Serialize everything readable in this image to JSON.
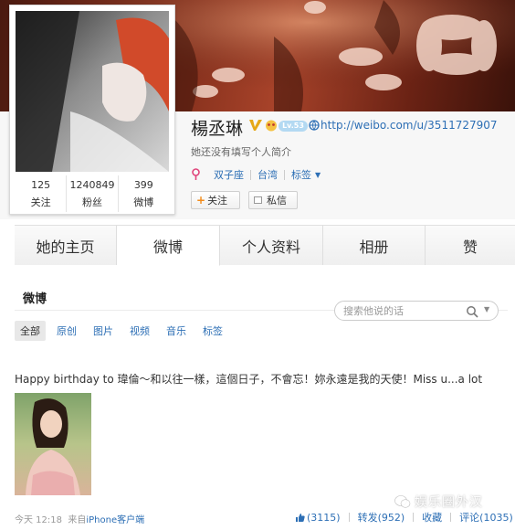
{
  "profile": {
    "name": "楊丞琳",
    "level_badge": "Lv.53",
    "url": "http://weibo.com/u/3511727907",
    "bio": "她还没有填写个人简介",
    "tags": [
      "双子座",
      "台湾",
      "标签"
    ],
    "follow_label": "关注",
    "message_label": "私信",
    "stats": [
      {
        "value": "125",
        "label": "关注"
      },
      {
        "value": "1240849",
        "label": "粉丝"
      },
      {
        "value": "399",
        "label": "微博"
      }
    ]
  },
  "tabs": [
    "她的主页",
    "微博",
    "个人资料",
    "相册",
    "赞"
  ],
  "active_tab": "微博",
  "section": {
    "title": "微博",
    "search_placeholder": "搜索他说的话",
    "filters": [
      "全部",
      "原创",
      "图片",
      "视频",
      "音乐",
      "标签"
    ],
    "active_filter": "全部"
  },
  "post": {
    "text": "Happy birthday to 瑋倫～和以往一樣，這個日子，不會忘！妳永遠是我的天使！Miss u...a lot",
    "time": "今天 12:18",
    "source_prefix": "来自",
    "source": "iPhone客户端",
    "likes": "(3115)",
    "repost": "转发(952)",
    "favorite": "收藏",
    "comment": "评论(1035)"
  },
  "watermark": "娱乐圈外汉",
  "colors": {
    "link": "#2d6fb5",
    "follow_plus": "#f28b1b",
    "banner": "#7a2a18"
  }
}
